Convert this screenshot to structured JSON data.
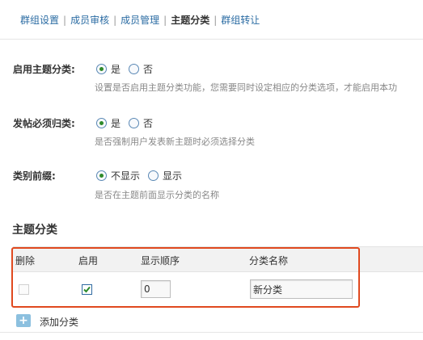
{
  "tabs": [
    {
      "label": "群组设置",
      "active": false
    },
    {
      "label": "成员审核",
      "active": false
    },
    {
      "label": "成员管理",
      "active": false
    },
    {
      "label": "主题分类",
      "active": true
    },
    {
      "label": "群组转让",
      "active": false
    }
  ],
  "tab_separator": "|",
  "settings": {
    "enable_category": {
      "label": "启用主题分类:",
      "options": [
        "是",
        "否"
      ],
      "selected": "是",
      "description": "设置是否启用主题分类功能，您需要同时设定相应的分类选项，才能启用本功"
    },
    "require_category": {
      "label": "发帖必须归类:",
      "options": [
        "是",
        "否"
      ],
      "selected": "是",
      "description": "是否强制用户发表新主题时必须选择分类"
    },
    "category_prefix": {
      "label": "类别前缀:",
      "options": [
        "不显示",
        "显示"
      ],
      "selected": "不显示",
      "description": "是否在主题前面显示分类的名称"
    }
  },
  "section": {
    "title": "主题分类"
  },
  "table": {
    "headers": [
      "删除",
      "启用",
      "显示顺序",
      "分类名称"
    ],
    "rows": [
      {
        "delete": false,
        "enabled": true,
        "order": "0",
        "name": "新分类"
      }
    ]
  },
  "add_button": {
    "label": "添加分类",
    "icon": "plus-icon"
  },
  "colors": {
    "link": "#2b6ca3",
    "highlight": "#e0491f",
    "radio_dot": "#2f8a2a",
    "add_icon": "#8cc0df"
  }
}
